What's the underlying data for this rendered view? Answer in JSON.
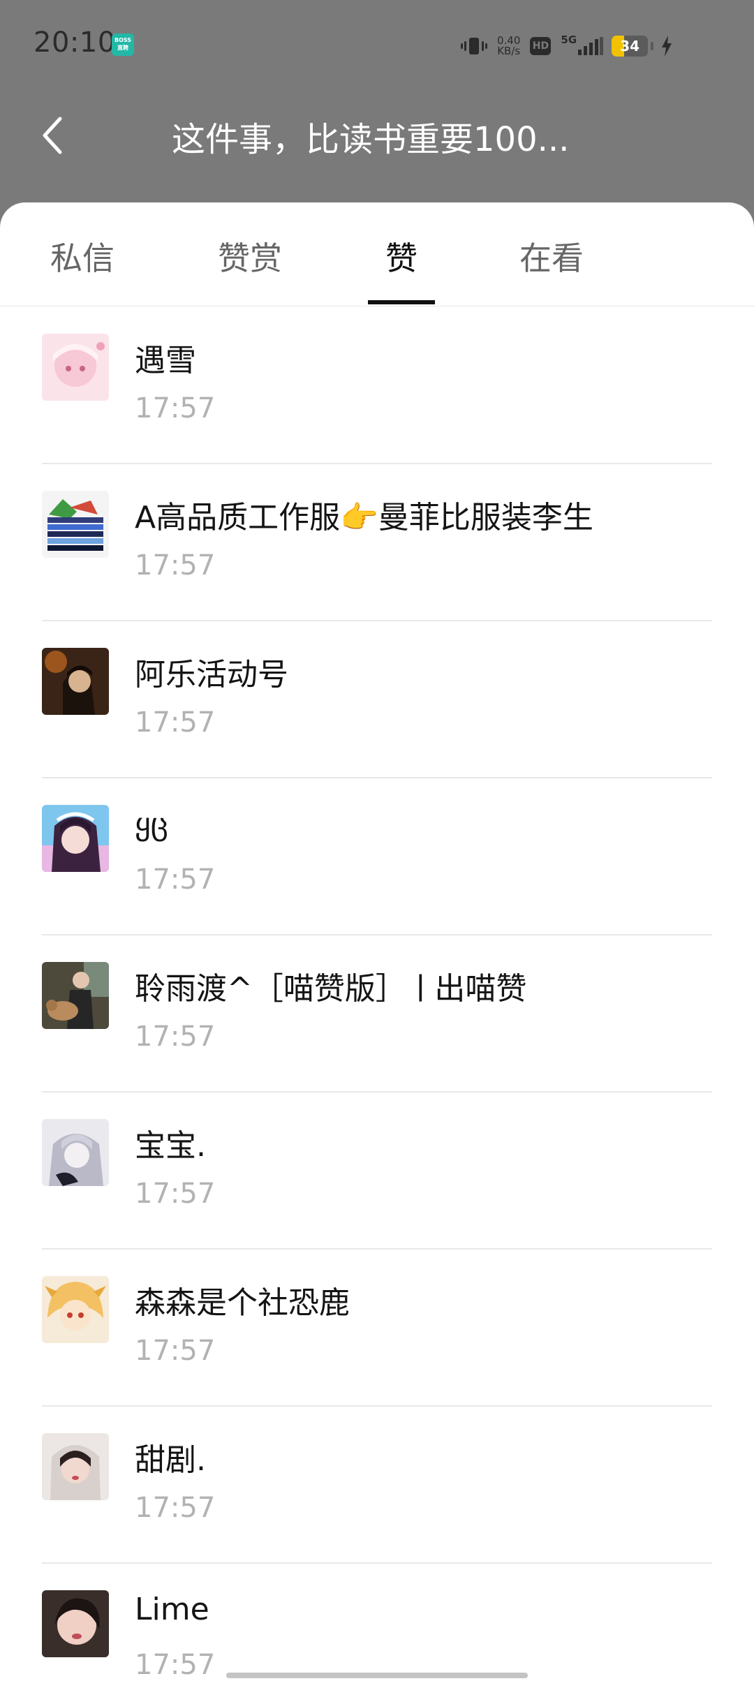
{
  "status_bar": {
    "time": "20:10",
    "app_badge": "BOSS\n直聘",
    "net_speed_value": "0.40",
    "net_speed_unit": "KB/s",
    "hd_label": "HD",
    "network": "5G",
    "battery_percent": "34",
    "battery_level": 0.34,
    "battery_color": "#f2c200"
  },
  "header": {
    "back_icon": "chevron-left-icon",
    "title": "这件事，比读书重要100..."
  },
  "tabs": [
    {
      "label": "私信",
      "active": false
    },
    {
      "label": "赞赏",
      "active": false
    },
    {
      "label": "赞",
      "active": true
    },
    {
      "label": "在看",
      "active": false
    }
  ],
  "likes": [
    {
      "name": "遇雪",
      "time": "17:57"
    },
    {
      "name": "A高品质工作服👉曼菲比服装李生",
      "time": "17:57"
    },
    {
      "name": "阿乐活动号",
      "time": "17:57"
    },
    {
      "name": "ყც",
      "time": "17:57"
    },
    {
      "name": "聆雨渡^［喵赞版］ㅣ出喵赞",
      "time": "17:57"
    },
    {
      "name": "宝宝.",
      "time": "17:57"
    },
    {
      "name": "森森是个社恐鹿",
      "time": "17:57"
    },
    {
      "name": "甜剧.",
      "time": "17:57"
    },
    {
      "name": "Lime",
      "time": "17:57"
    }
  ]
}
